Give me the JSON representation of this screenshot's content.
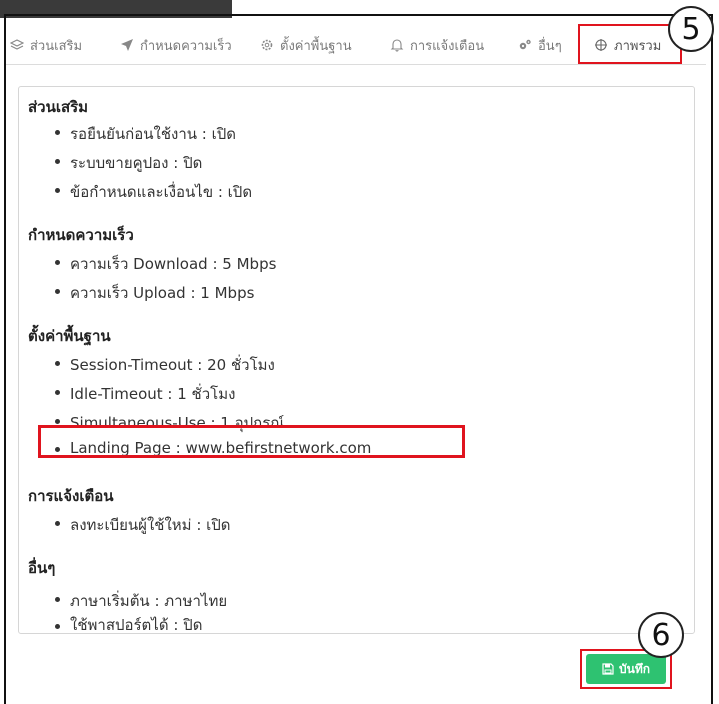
{
  "tabs": [
    {
      "label": "ส่วนเสริม",
      "icon": "layers-icon"
    },
    {
      "label": "กำหนดความเร็ว",
      "icon": "location-arrow-icon"
    },
    {
      "label": "ตั้งค่าพื้นฐาน",
      "icon": "gear-icon"
    },
    {
      "label": "การแจ้งเตือน",
      "icon": "bell-icon"
    },
    {
      "label": "อื่นๆ",
      "icon": "gears-icon"
    },
    {
      "label": "ภาพรวม",
      "icon": "crosshair-icon",
      "active": true
    }
  ],
  "annotations": {
    "step5": "5",
    "step6": "6"
  },
  "sections": [
    {
      "title": "ส่วนเสริม",
      "items": [
        "รอยืนยันก่อนใช้งาน : เปิด",
        "ระบบขายคูปอง : ปิด",
        "ข้อกำหนดและเงื่อนไข : เปิด"
      ]
    },
    {
      "title": "กำหนดความเร็ว",
      "items": [
        "ความเร็ว Download : 5 Mbps",
        "ความเร็ว Upload : 1 Mbps"
      ]
    },
    {
      "title": "ตั้งค่าพื้นฐาน",
      "items": [
        "Session-Timeout : 20 ชั่วโมง",
        "Idle-Timeout : 1 ชั่วโมง",
        "Simultaneous-Use : 1 อุปกรณ์",
        "Landing Page : www.befirstnetwork.com"
      ]
    },
    {
      "title": "การแจ้งเตือน",
      "items": [
        "ลงทะเบียนผู้ใช้ใหม่ : เปิด"
      ]
    },
    {
      "title": "อื่นๆ",
      "items": [
        "ภาษาเริ่มต้น : ภาษาไทย",
        "ใช้พาสปอร์ตได้ : ปิด"
      ]
    }
  ],
  "save_button": {
    "label": "บันทึก",
    "icon": "floppy-disk-icon",
    "color": "#2ec271"
  },
  "colors": {
    "highlight": "#e0141e"
  }
}
